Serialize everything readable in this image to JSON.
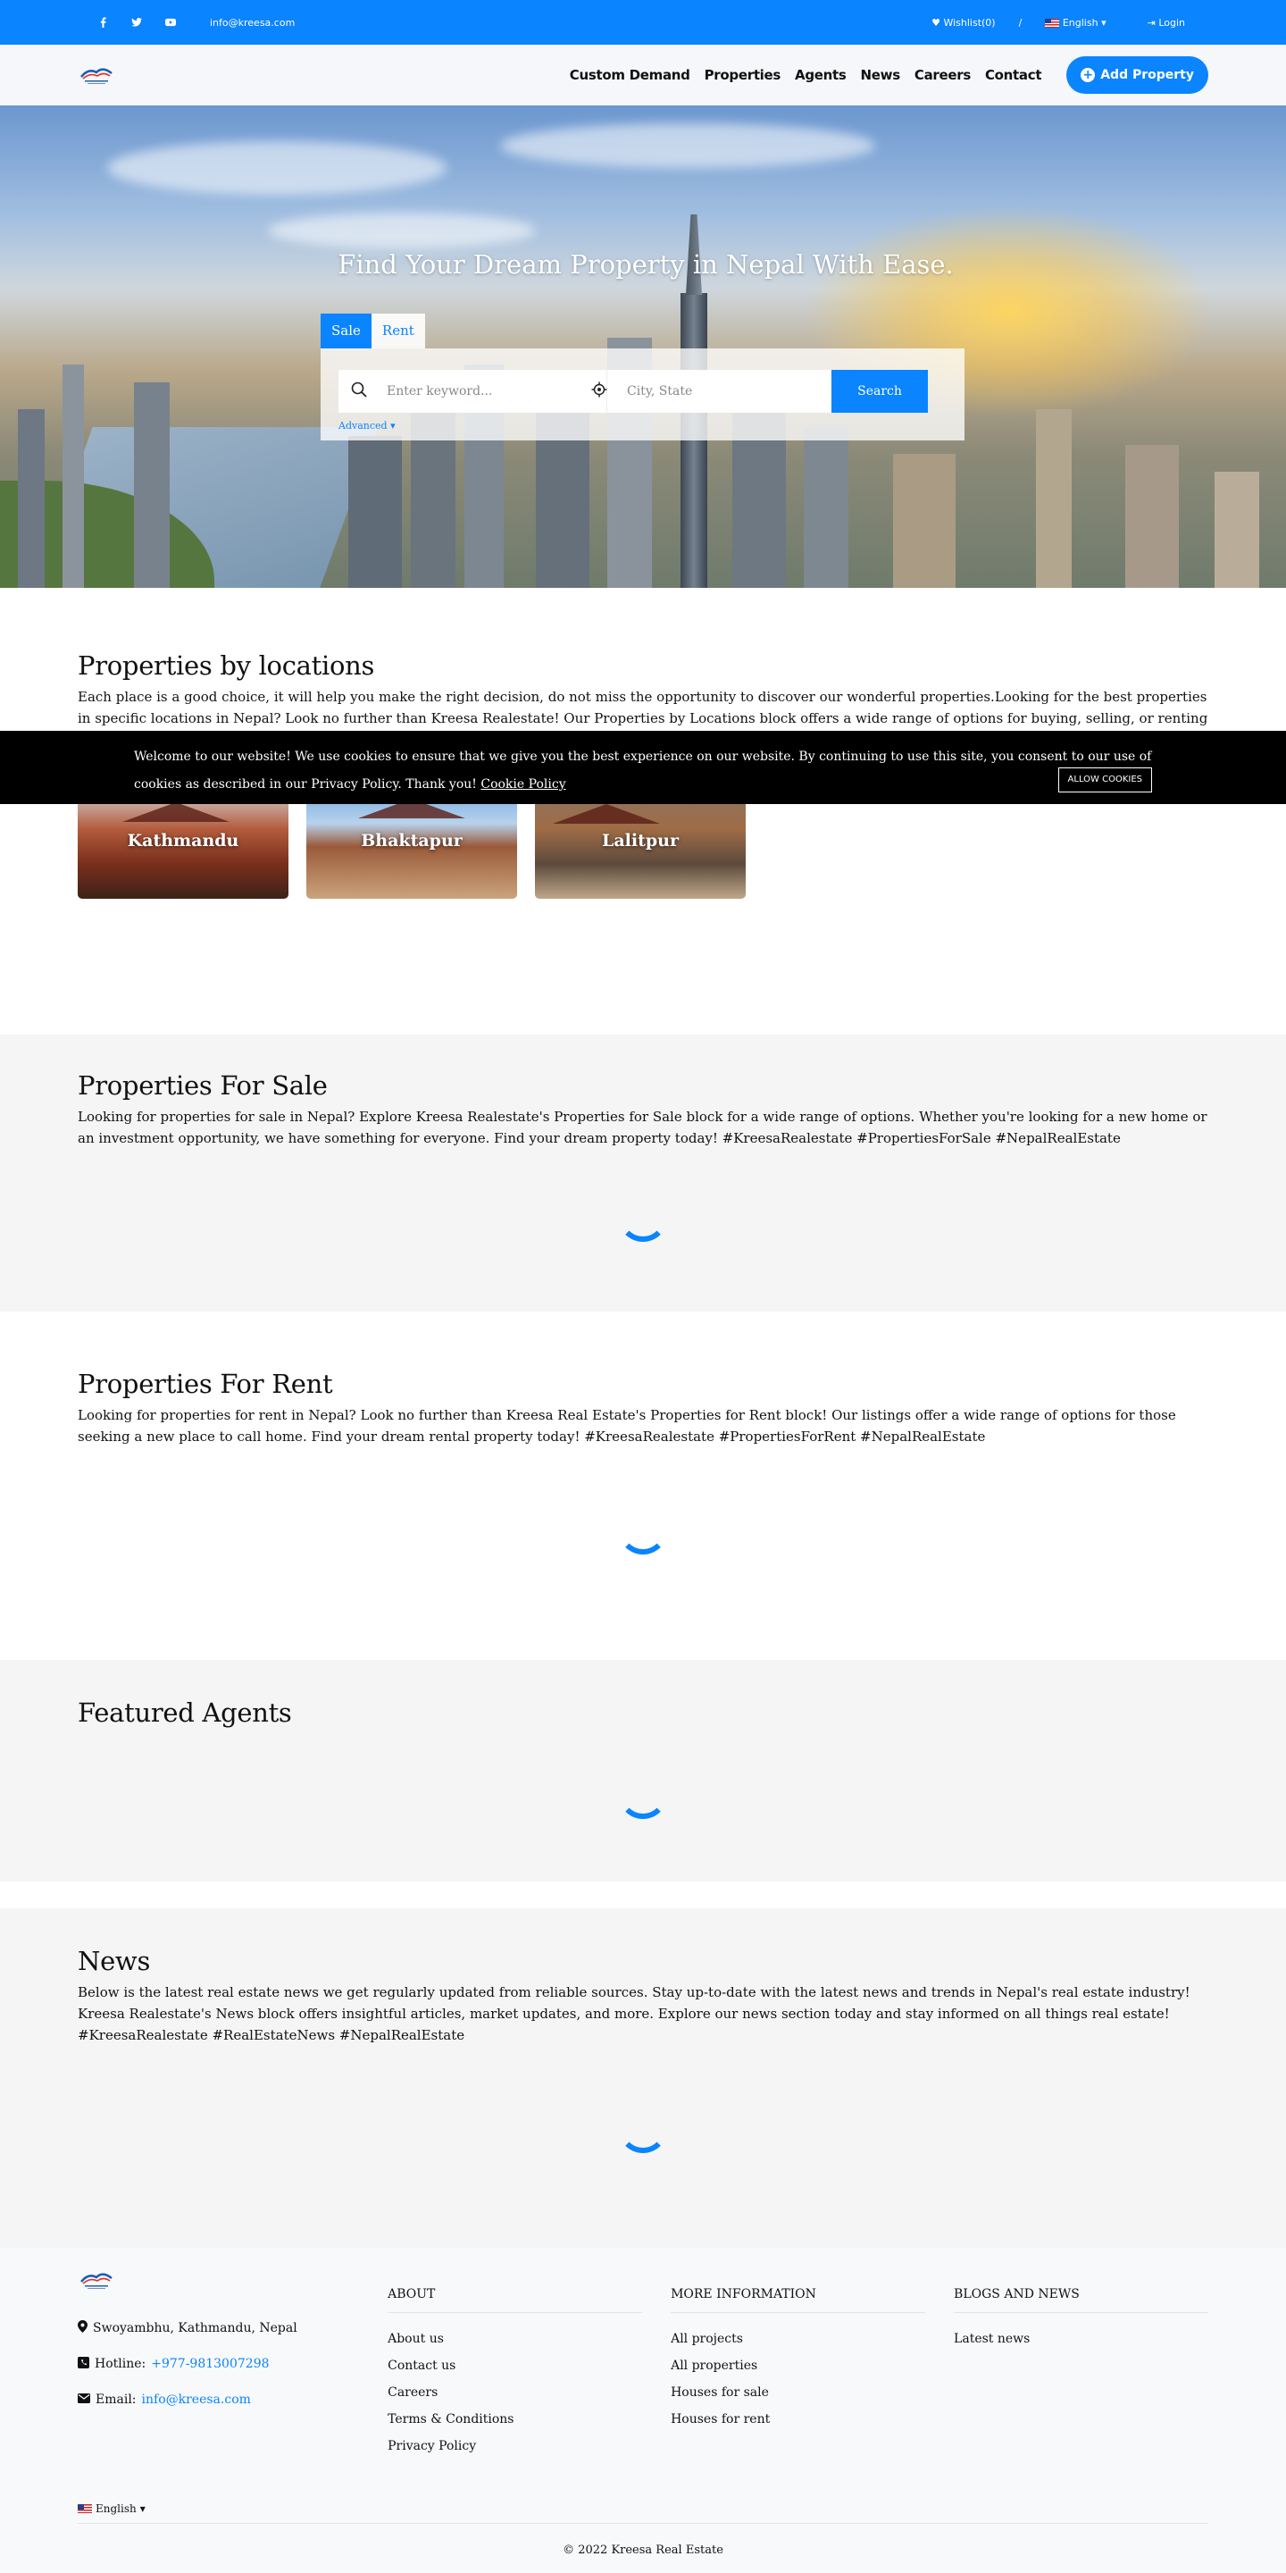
{
  "topbar": {
    "email": "info@kreesa.com",
    "wishlist": "Wishlist(0)",
    "separator": "/",
    "language": "English",
    "login": "Login",
    "social_icons": [
      "facebook-icon",
      "twitter-icon",
      "youtube-icon"
    ]
  },
  "nav": {
    "items": [
      "Custom Demand",
      "Properties",
      "Agents",
      "News",
      "Careers",
      "Contact"
    ],
    "add_property": "Add Property"
  },
  "hero": {
    "title": "Find Your Dream Property in Nepal With Ease.",
    "tabs": [
      "Sale",
      "Rent"
    ],
    "keyword_placeholder": "Enter keyword...",
    "location_placeholder": "City, State",
    "search_label": "Search",
    "advanced": "Advanced"
  },
  "locations": {
    "title": "Properties by locations",
    "desc": "Each place is a good choice, it will help you make the right decision, do not miss the opportunity to discover our wonderful properties.Looking for the best properties in specific locations in Nepal? Look no further than Kreesa Realestate! Our Properties by Locations block offers a wide range of options for buying, selling, or renting real estate in your",
    "cards": [
      "Kathmandu",
      "Bhaktapur",
      "Lalitpur"
    ]
  },
  "cookie": {
    "text": "Welcome to our website! We use cookies to ensure that we give you the best experience on our website. By continuing to use this site, you consent to our use of cookies as described in our Privacy Policy. Thank you!",
    "link": "Cookie Policy",
    "button": "ALLOW COOKIES"
  },
  "sale": {
    "title": "Properties For Sale",
    "desc": "Looking for properties for sale in Nepal? Explore Kreesa Realestate's Properties for Sale block for a wide range of options. Whether you're looking for a new home or an investment opportunity, we have something for everyone. Find your dream property today! #KreesaRealestate #PropertiesForSale #NepalRealEstate"
  },
  "rent": {
    "title": "Properties For Rent",
    "desc": "Looking for properties for rent in Nepal? Look no further than Kreesa Real Estate's Properties for Rent block! Our listings offer a wide range of options for those seeking a new place to call home. Find your dream rental property today! #KreesaRealestate #PropertiesForRent #NepalRealEstate"
  },
  "agents": {
    "title": "Featured Agents"
  },
  "news": {
    "title": "News",
    "desc": "Below is the latest real estate news we get regularly updated from reliable sources. Stay up-to-date with the latest news and trends in Nepal's real estate industry! Kreesa Realestate's News block offers insightful articles, market updates, and more. Explore our news section today and stay informed on all things real estate! #KreesaRealestate #RealEstateNews #NepalRealEstate"
  },
  "footer": {
    "address": "Swoyambhu, Kathmandu, Nepal",
    "hotline_label": "Hotline:",
    "hotline": "+977-9813007298",
    "email_label": "Email:",
    "email": "info@kreesa.com",
    "about": {
      "title": "ABOUT",
      "links": [
        "About us",
        "Contact us",
        "Careers",
        "Terms & Conditions",
        "Privacy Policy"
      ]
    },
    "more": {
      "title": "MORE INFORMATION",
      "links": [
        "All projects",
        "All properties",
        "Houses for sale",
        "Houses for rent"
      ]
    },
    "blogs": {
      "title": "BLOGS AND NEWS",
      "links": [
        "Latest news"
      ]
    },
    "language": "English",
    "copyright": "© 2022 Kreesa Real Estate"
  },
  "colors": {
    "primary": "#0a84ff",
    "cookie_bg": "#000000",
    "grey_section": "#f5f5f5"
  }
}
